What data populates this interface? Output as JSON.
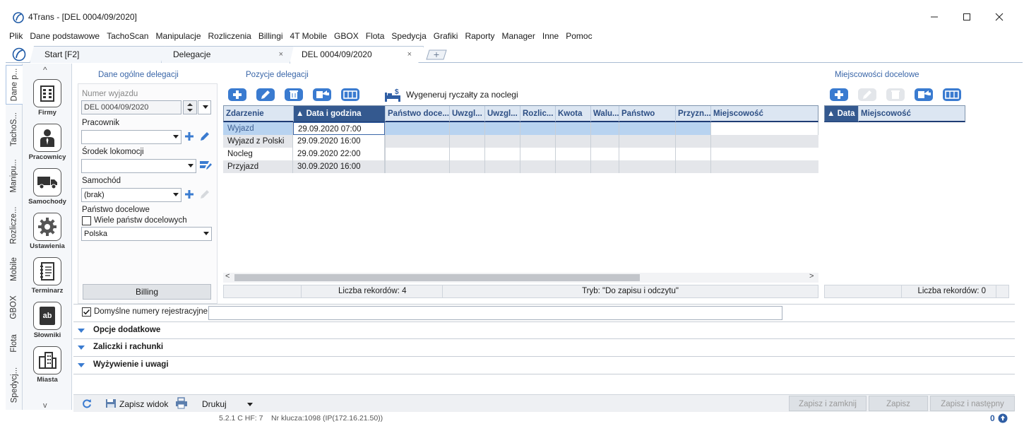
{
  "window": {
    "title": "4Trans - [DEL 0004/09/2020]",
    "minimize": "—",
    "maximize": "☐",
    "close": "✕"
  },
  "menu": [
    "Plik",
    "Dane podstawowe",
    "TachoScan",
    "Manipulacje",
    "Rozliczenia",
    "Billingi",
    "4T Mobile",
    "GBOX",
    "Flota",
    "Spedycja",
    "Grafiki",
    "Raporty",
    "Manager",
    "Inne",
    "Pomoc"
  ],
  "tabs": {
    "start": "Start [F2]",
    "delegacje": "Delegacje",
    "active": "DEL 0004/09/2020",
    "close_glyph": "×"
  },
  "vertical_tabs": [
    "Dane p...",
    "TachoS...",
    "Manipu...",
    "Rozlicze...",
    "Mobile",
    "GBOX",
    "Flota",
    "Spedycj..."
  ],
  "launcher": {
    "up": "^",
    "down": "v",
    "items": [
      "Firmy",
      "Pracownicy",
      "Samochody",
      "Ustawienia",
      "Terminarz",
      "Słowniki",
      "Miasta"
    ],
    "slowniki_icon_text": "ab"
  },
  "general": {
    "title": "Dane ogólne delegacji",
    "trip_number_label": "Numer wyjazdu",
    "trip_number_value": "DEL 0004/09/2020",
    "employee_label": "Pracownik",
    "employee_value": "",
    "transport_label": "Środek lokomocji",
    "transport_value": "",
    "car_label": "Samochód",
    "car_value": "(brak)",
    "country_label": "Państwo docelowe",
    "multi_country_label": "Wiele państw docelowych",
    "multi_country_checked": false,
    "country_value": "Polska",
    "billing_button": "Billing"
  },
  "positions": {
    "title": "Pozycje delegacji",
    "generate_label": "Wygeneruj ryczałty za noclegi",
    "columns": [
      "Zdarzenie",
      "▲ Data i godzina",
      "Państwo doce...",
      "Uwzgl...",
      "Uwzgl...",
      "Rozlic...",
      "Kwota",
      "Walu...",
      "Państwo",
      "Przyzn...",
      "Miejscowość"
    ],
    "rows": [
      [
        "Wyjazd",
        "29.09.2020 07:00"
      ],
      [
        "Wyjazd z Polski",
        "29.09.2020 16:00"
      ],
      [
        "Nocleg",
        "29.09.2020 22:00"
      ],
      [
        "Przyjazd",
        "30.09.2020 16:00"
      ]
    ],
    "scroll_left": "<",
    "scroll_right": ">",
    "record_count": "Liczba rekordów: 4",
    "mode": "Tryb: \"Do zapisu i odczytu\""
  },
  "destinations": {
    "title": "Miejscowości docelowe",
    "columns": [
      "▲ Data",
      "Miejscowość"
    ],
    "record_count": "Liczba rekordów: 0"
  },
  "reg_numbers": {
    "label": "Domyślne numery rejestracyjne",
    "checked": true,
    "value": ""
  },
  "accordions": [
    "Opcje dodatkowe",
    "Zaliczki i rachunki",
    "Wyżywienie i uwagi"
  ],
  "bottom": {
    "save_view": "Zapisz widok",
    "print": "Drukuj",
    "save_close": "Zapisz i zamknij",
    "save": "Zapisz",
    "save_next": "Zapisz i następny"
  },
  "footer": {
    "version": "5.2.1 C HF: 7",
    "key": "Nr klucza:1098 (IP(172.16.21.50))",
    "notifications": "0"
  },
  "colors": {
    "accent": "#3a7bd0",
    "header_sorted": "#34598f",
    "selected_row": "#b8d3f0",
    "alt_row": "#e4e6ea"
  }
}
